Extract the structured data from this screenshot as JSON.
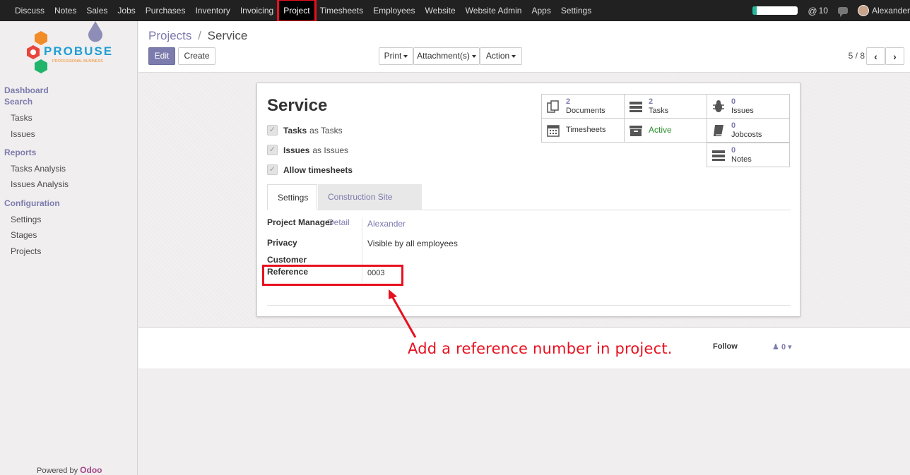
{
  "topbar": {
    "menu": [
      "Discuss",
      "Notes",
      "Sales",
      "Jobs",
      "Purchases",
      "Inventory",
      "Invoicing",
      "Project",
      "Timesheets",
      "Employees",
      "Website",
      "Website Admin",
      "Apps",
      "Settings"
    ],
    "active_menu": "Project",
    "progress_fraction": 0.08,
    "notifications": "10",
    "user": "Alexander",
    "icons": [
      "at-icon",
      "chat-icon",
      "avatar"
    ]
  },
  "sidebar": {
    "logo_text": "PROBUSE",
    "logo_subtext": "PROFESSIONAL BUSINESS",
    "groups": [
      {
        "label": "Dashboard",
        "items": []
      },
      {
        "label": "Search",
        "items": [
          "Tasks",
          "Issues"
        ]
      },
      {
        "label": "Reports",
        "items": [
          "Tasks Analysis",
          "Issues Analysis"
        ]
      },
      {
        "label": "Configuration",
        "items": [
          "Settings",
          "Stages",
          "Projects"
        ]
      }
    ],
    "powered_prefix": "Powered by",
    "powered_brand": "Odoo"
  },
  "control_panel": {
    "breadcrumb_parent": "Projects",
    "breadcrumb_sep": "/",
    "breadcrumb_current": "Service",
    "edit_label": "Edit",
    "create_label": "Create",
    "print_label": "Print",
    "attachments_label": "Attachment(s)",
    "action_label": "Action",
    "pager": "5 / 8"
  },
  "form": {
    "title": "Service",
    "checkboxes": [
      {
        "bold": "Tasks",
        "rest": "as Tasks"
      },
      {
        "bold": "Issues",
        "rest": "as Issues"
      },
      {
        "bold": "Allow timesheets",
        "rest": ""
      }
    ],
    "smart_buttons": [
      {
        "count": "2",
        "label": "Documents",
        "icon": "documents-icon"
      },
      {
        "count": "2",
        "label": "Tasks",
        "icon": "tasks-icon"
      },
      {
        "count": "0",
        "label": "Issues",
        "icon": "bug-icon"
      },
      {
        "count": "",
        "label": "Timesheets",
        "icon": "calendar-icon"
      },
      {
        "count": "",
        "label": "Active",
        "icon": "archive-icon"
      },
      {
        "count": "0",
        "label": "Jobcosts",
        "icon": "book-icon"
      },
      {
        "count": "0",
        "label": "Notes",
        "icon": "notes-icon"
      }
    ],
    "tabs": [
      "Settings",
      "Construction Site Detail"
    ],
    "fields": {
      "project_manager_label": "Project Manager",
      "project_manager_value": "Alexander",
      "privacy_label": "Privacy",
      "privacy_value": "Visible by all employees",
      "customer_label": "Customer",
      "reference_label": "Reference",
      "reference_value": "0003"
    }
  },
  "chatter": {
    "follow_label": "Follow",
    "followers_count": "0"
  },
  "annotation": {
    "text": "Add a reference number in project.",
    "color": "#e8101f"
  },
  "colors": {
    "accent": "#7c7bad",
    "highlight": "#e8101f",
    "active_green": "#2d8f2d"
  }
}
